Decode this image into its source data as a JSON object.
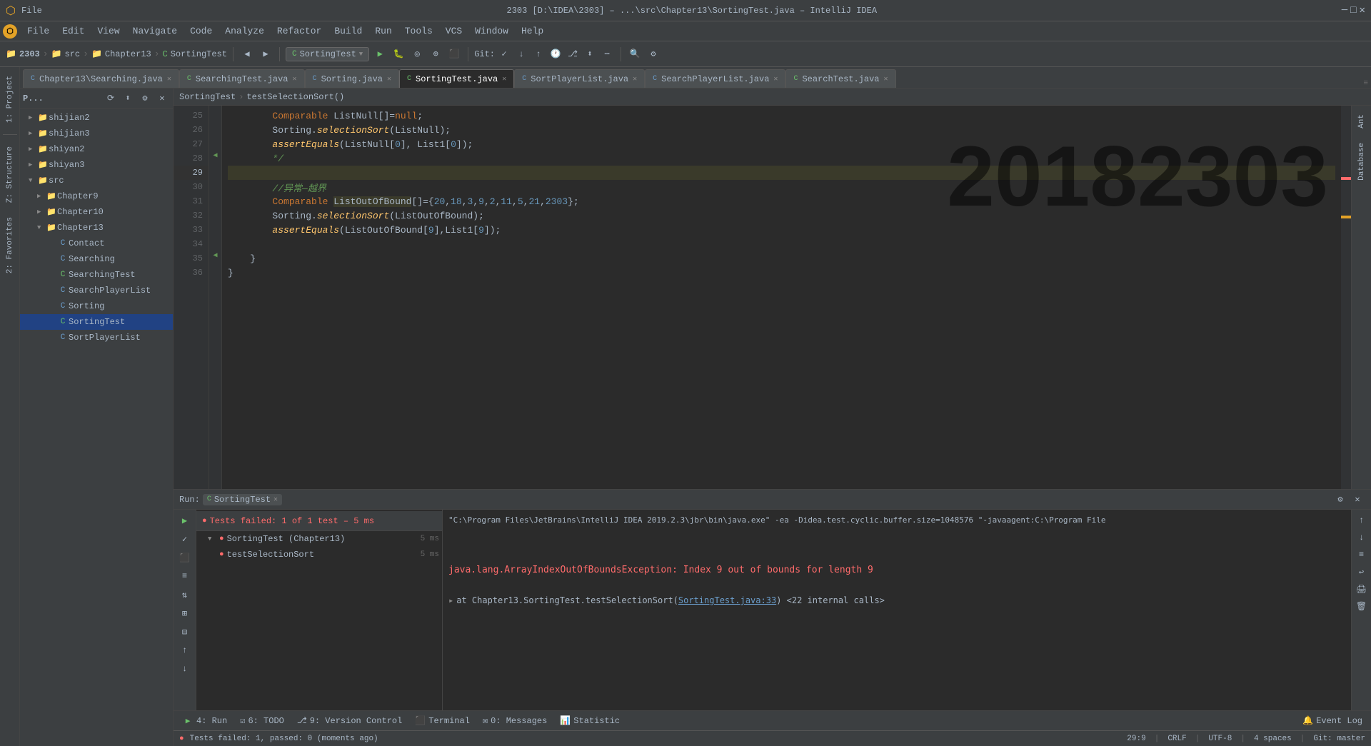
{
  "titleBar": {
    "title": "2303 [D:\\IDEA\\2303] – ...\\src\\Chapter13\\SortingTest.java – IntelliJ IDEA",
    "appName": "IntelliJ IDEA",
    "btnMinimize": "–",
    "btnMaximize": "□",
    "btnClose": "✕"
  },
  "menuBar": {
    "items": [
      "File",
      "Edit",
      "View",
      "Navigate",
      "Code",
      "Analyze",
      "Refactor",
      "Build",
      "Run",
      "Tools",
      "VCS",
      "Window",
      "Help"
    ]
  },
  "toolbar": {
    "projectName": "2303",
    "src": "src",
    "chapter": "Chapter13",
    "file": "SortingTest",
    "runConfig": "SortingTest",
    "gitLabel": "Git:",
    "branchLabel": "master"
  },
  "tabBar": {
    "tabs": [
      {
        "label": "Chapter13\\Searching.java",
        "active": false,
        "icon": "C"
      },
      {
        "label": "SearchingTest.java",
        "active": false,
        "icon": "C"
      },
      {
        "label": "Sorting.java",
        "active": false,
        "icon": "C"
      },
      {
        "label": "SortingTest.java",
        "active": true,
        "icon": "C"
      },
      {
        "label": "SortPlayerList.java",
        "active": false,
        "icon": "C"
      },
      {
        "label": "SearchPlayerList.java",
        "active": false,
        "icon": "C"
      },
      {
        "label": "SearchTest.java",
        "active": false,
        "icon": "C"
      }
    ]
  },
  "sidebar": {
    "projectLabel": "P...",
    "items": [
      {
        "label": "shijian2",
        "type": "folder",
        "indent": 1,
        "expanded": false
      },
      {
        "label": "shijian3",
        "type": "folder",
        "indent": 1,
        "expanded": false
      },
      {
        "label": "shiyan2",
        "type": "folder",
        "indent": 1,
        "expanded": false
      },
      {
        "label": "shiyan3",
        "type": "folder",
        "indent": 1,
        "expanded": false
      },
      {
        "label": "src",
        "type": "folder",
        "indent": 1,
        "expanded": true
      },
      {
        "label": "Chapter9",
        "type": "folder",
        "indent": 2,
        "expanded": false
      },
      {
        "label": "Chapter10",
        "type": "folder",
        "indent": 2,
        "expanded": false
      },
      {
        "label": "Chapter13",
        "type": "folder",
        "indent": 2,
        "expanded": true
      },
      {
        "label": "Contact",
        "type": "java",
        "indent": 3
      },
      {
        "label": "Searching",
        "type": "java",
        "indent": 3
      },
      {
        "label": "SearchingTest",
        "type": "javatest",
        "indent": 3
      },
      {
        "label": "SearchPlayerList",
        "type": "java",
        "indent": 3
      },
      {
        "label": "Sorting",
        "type": "java",
        "indent": 3
      },
      {
        "label": "SortingTest",
        "type": "javatest",
        "indent": 3,
        "selected": true
      },
      {
        "label": "SortPlayerList",
        "type": "java",
        "indent": 3
      }
    ]
  },
  "editor": {
    "lines": [
      {
        "num": 25,
        "code": "        Comparable ListNull[]=null;",
        "type": "normal"
      },
      {
        "num": 26,
        "code": "        Sorting.selectionSort(ListNull);",
        "type": "normal"
      },
      {
        "num": 27,
        "code": "        assertEquals(ListNull[0], List1[0]);",
        "type": "normal"
      },
      {
        "num": 28,
        "code": "        */",
        "type": "comment"
      },
      {
        "num": 29,
        "code": "",
        "type": "highlighted"
      },
      {
        "num": 30,
        "code": "        //异常—越界",
        "type": "comment"
      },
      {
        "num": 31,
        "code": "        Comparable ListOutOfBound[]={20,18,3,9,2,11,5,21,2303};",
        "type": "normal"
      },
      {
        "num": 32,
        "code": "        Sorting.selectionSort(ListOutOfBound);",
        "type": "normal"
      },
      {
        "num": 33,
        "code": "        assertEquals(ListOutOfBound[9],List1[9]);",
        "type": "normal"
      },
      {
        "num": 34,
        "code": "",
        "type": "normal"
      },
      {
        "num": 35,
        "code": "    }",
        "type": "normal"
      },
      {
        "num": 36,
        "code": "}",
        "type": "normal"
      }
    ],
    "breadcrumb": "SortingTest › testSelectionSort()",
    "watermark": "20182303"
  },
  "runPanel": {
    "title": "Run:",
    "tabLabel": "SortingTest",
    "status": "Tests failed: 1 of 1 test – 5 ms",
    "testTree": [
      {
        "label": "SortingTest (Chapter13)",
        "time": "5 ms",
        "status": "fail",
        "indent": 0
      },
      {
        "label": "testSelectionSort",
        "time": "5 ms",
        "status": "fail",
        "indent": 1
      }
    ],
    "output": {
      "command": "\"C:\\Program Files\\JetBrains\\IntelliJ IDEA 2019.2.3\\jbr\\bin\\java.exe\" -ea -Didea.test.cyclic.buffer.size=1048576 \"-javaagent:C:\\Program File",
      "errorMain": "java.lang.ArrayIndexOutOfBoundsException: Index 9 out of bounds for length 9",
      "errorAt": "at Chapter13.SortingTest.testSelectionSort(",
      "errorLink": "SortingTest.java:33",
      "errorSuffix": ") <22 internal calls>"
    }
  },
  "bottomToolbar": {
    "items": [
      "4: Run",
      "6: TODO",
      "9: Version Control",
      "Terminal",
      "0: Messages",
      "Statistic"
    ]
  },
  "statusBar": {
    "message": "Tests failed: 1, passed: 0 (moments ago)",
    "position": "29:9",
    "encoding": "CRLF",
    "fileEncoding": "UTF-8",
    "indent": "4 spaces",
    "branch": "Git: master",
    "eventLog": "Event Log"
  }
}
